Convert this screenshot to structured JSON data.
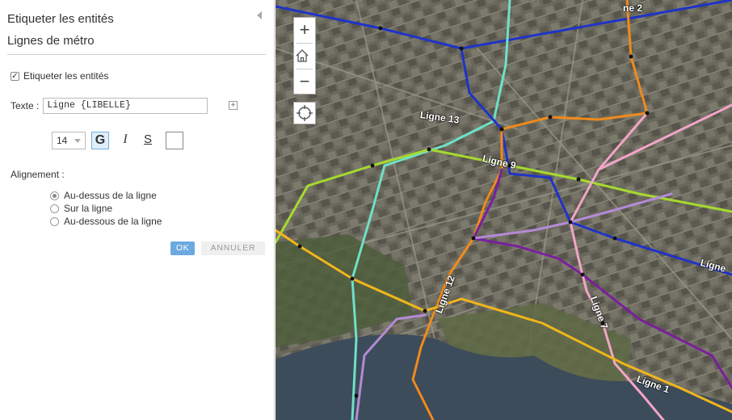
{
  "panel": {
    "title": "Etiqueter les entités",
    "subtitle": "Lignes de métro",
    "label_checkbox": "Etiqueter les entités",
    "label_checkbox_checked": true,
    "text_label": "Texte :",
    "text_value": "Ligne {LIBELLE}",
    "font_size": "14",
    "bold_label": "G",
    "italic_label": "I",
    "strike_label": "S",
    "alignment_label": "Alignement :",
    "alignment_options": [
      "Au-dessus de la ligne",
      "Sur la ligne",
      "Au-dessous de la ligne"
    ],
    "alignment_selected": 0,
    "ok_label": "OK",
    "cancel_label": "ANNULER"
  },
  "map": {
    "zoom_in": "+",
    "zoom_out": "−",
    "labels": {
      "ligne2": "ne 2",
      "ligne13": "Ligne 13",
      "ligne9": "Ligne 9",
      "ligne12": "Ligne 12",
      "ligne7": "Ligne 7",
      "ligne1": "Ligne 1",
      "ligne_partial": "Ligne"
    },
    "line_colors": {
      "ligne13": "#6fe0c8",
      "ligne9": "#a6d92f",
      "ligne12": "#f08a1c",
      "ligne7": "#f2a5c7",
      "ligne1": "#f2b51c",
      "blue": "#1f33c8",
      "purple": "#7a1f9e",
      "lilac": "#b38bd6"
    }
  }
}
